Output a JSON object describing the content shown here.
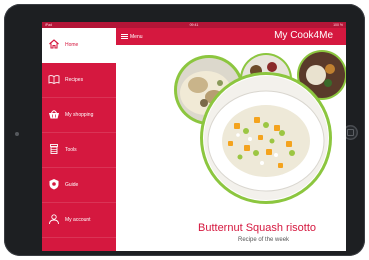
{
  "statusbar": {
    "carrier": "iPad",
    "time": "09:41",
    "battery": "100 %"
  },
  "header": {
    "menu_label": "Menu",
    "title": "My Cook4Me"
  },
  "sidebar": {
    "items": [
      {
        "label": "Home",
        "icon": "home-icon",
        "active": true
      },
      {
        "label": "Recipes",
        "icon": "book-icon",
        "active": false
      },
      {
        "label": "My shopping",
        "icon": "basket-icon",
        "active": false
      },
      {
        "label": "Tools",
        "icon": "pot-icon",
        "active": false
      },
      {
        "label": "Guide",
        "icon": "guide-icon",
        "active": false
      },
      {
        "label": "My account",
        "icon": "user-icon",
        "active": false
      }
    ]
  },
  "featured": {
    "title": "Butternut Squash risotto",
    "subtitle": "Recipe of the week"
  },
  "colors": {
    "brand": "#d5183f",
    "brand_dark": "#b41537",
    "accent_green": "#8cc63f"
  }
}
